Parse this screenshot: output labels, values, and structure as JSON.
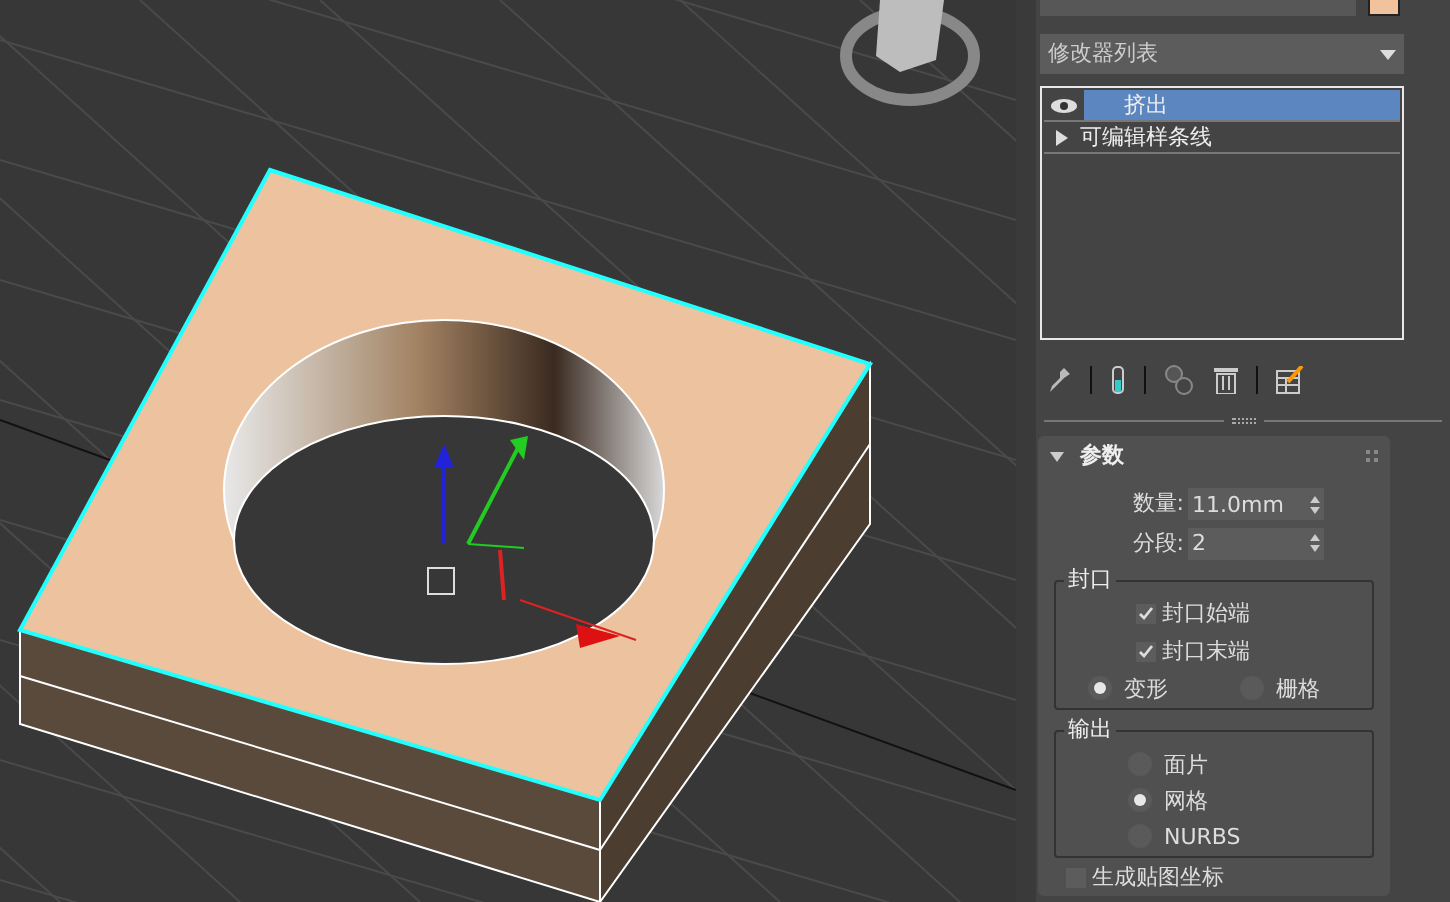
{
  "modifier_dropdown": {
    "label": "修改器列表"
  },
  "modifier_stack": [
    {
      "kind": "modifier",
      "label": "挤出",
      "selected": true
    },
    {
      "kind": "base",
      "label": "可编辑样条线",
      "selected": false
    }
  ],
  "rollout": {
    "title": "参数",
    "expanded": true,
    "fields": [
      {
        "label": "数量:",
        "value": "11.0mm"
      },
      {
        "label": "分段:",
        "value": "2"
      }
    ],
    "groups": [
      {
        "title": "封口",
        "checkboxes": [
          {
            "label": "封口始端",
            "checked": true
          },
          {
            "label": "封口末端",
            "checked": true
          }
        ],
        "radios": [
          {
            "label": "变形",
            "selected": true
          },
          {
            "label": "栅格",
            "selected": false
          }
        ],
        "kind": "row"
      },
      {
        "title": "输出",
        "radios": [
          {
            "label": "面片",
            "selected": false
          },
          {
            "label": "网格",
            "selected": true
          },
          {
            "label": "NURBS",
            "selected": false
          }
        ],
        "kind": "column"
      }
    ],
    "trailing_checkbox": {
      "label": "生成贴图坐标",
      "checked": false
    }
  }
}
